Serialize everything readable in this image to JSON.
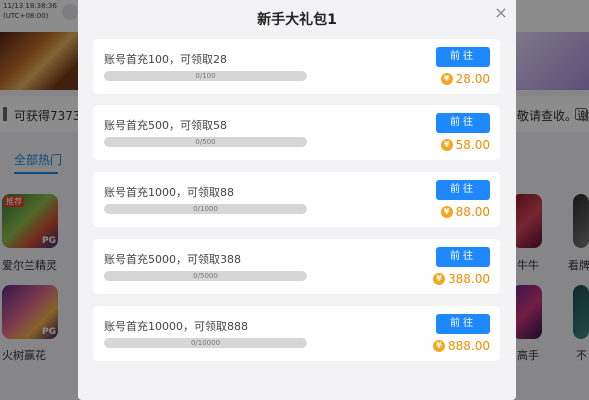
{
  "background": {
    "clock": {
      "line1": "11/13 18:38:36",
      "line2": "(UTC+08:00)"
    },
    "notice_left": "可获得7373",
    "notice_right": "敬请查收。谢",
    "tab_label": "全部热门",
    "hot_badge": "推荐",
    "pg_badge": "PG",
    "games": [
      "爱尔兰精灵",
      "火树赢花",
      "牛牛",
      "高手",
      "看牌",
      "不"
    ]
  },
  "modal": {
    "title": "新手大礼包1",
    "close_icon": "close-icon",
    "coin_symbol": "¥",
    "items": [
      {
        "title": "账号首充100，可领取28",
        "progress_text": "0/100",
        "progress": 0,
        "button": "前往",
        "reward": "28.00"
      },
      {
        "title": "账号首充500，可领取58",
        "progress_text": "0/500",
        "progress": 0,
        "button": "前往",
        "reward": "58.00"
      },
      {
        "title": "账号首充1000，可领取88",
        "progress_text": "0/1000",
        "progress": 0,
        "button": "前往",
        "reward": "88.00"
      },
      {
        "title": "账号首充5000，可领取388",
        "progress_text": "0/5000",
        "progress": 0,
        "button": "前往",
        "reward": "388.00"
      },
      {
        "title": "账号首充10000，可领取888",
        "progress_text": "0/10000",
        "progress": 0,
        "button": "前往",
        "reward": "888.00"
      }
    ]
  },
  "colors": {
    "accent": "#1e88ff",
    "reward": "#f08c00",
    "coin": "#f5a623"
  }
}
